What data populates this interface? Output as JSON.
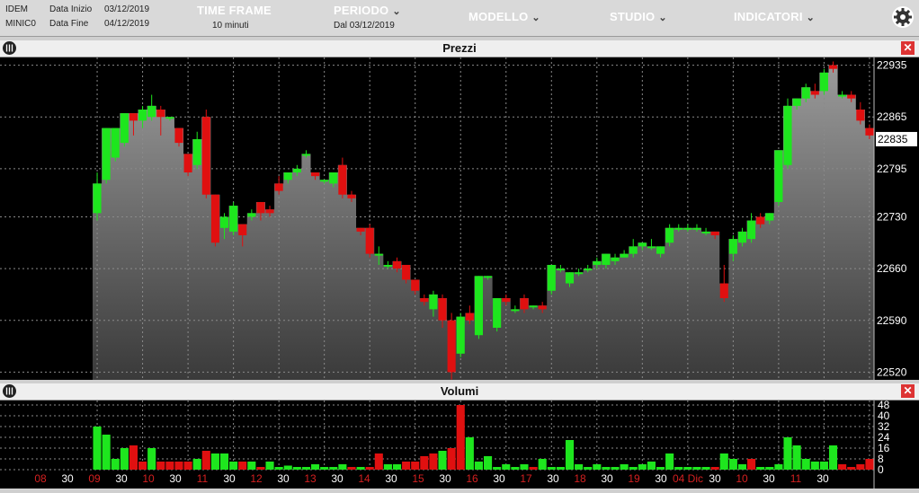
{
  "header": {
    "market": "IDEM",
    "symbol": "MINIC0",
    "start_label": "Data Inizio",
    "start_value": "03/12/2019",
    "end_label": "Data Fine",
    "end_value": "04/12/2019",
    "timeframe_label": "TIME FRAME",
    "timeframe_value": "10 minuti",
    "period_label": "PERIODO",
    "period_value": "Dal 03/12/2019",
    "menu_model": "MODELLO",
    "menu_study": "STUDIO",
    "menu_indicators": "INDICATORI",
    "settings_icon": "gear-icon",
    "close_icon": "close-icon"
  },
  "chart_data": [
    {
      "type": "candlestick",
      "title": "Prezzi",
      "y_ticks": [
        22520,
        22590,
        22660,
        22730,
        22795,
        22865,
        22935
      ],
      "ylim": [
        22512,
        22943
      ],
      "last_price": "22835",
      "x_tick_labels": [
        "08",
        "30",
        "09",
        "30",
        "10",
        "30",
        "11",
        "30",
        "12",
        "30",
        "13",
        "30",
        "14",
        "30",
        "15",
        "30",
        "16",
        "30",
        "17",
        "30",
        "18",
        "30",
        "19",
        "30",
        "04 Dic",
        "30",
        "10",
        "30",
        "11",
        "30"
      ],
      "colors": {
        "up": "#1ee61e",
        "down": "#e01010",
        "area_top": "#9a9a9a",
        "area_bottom": "#3a3a3a"
      },
      "candles": [
        {
          "o": 22735,
          "h": 22790,
          "c": 22775,
          "l": 22725
        },
        {
          "o": 22780,
          "h": 22850,
          "c": 22850,
          "l": 22775
        },
        {
          "o": 22810,
          "h": 22850,
          "c": 22850,
          "l": 22805
        },
        {
          "o": 22830,
          "h": 22870,
          "c": 22870,
          "l": 22825
        },
        {
          "o": 22870,
          "h": 22870,
          "c": 22860,
          "l": 22840
        },
        {
          "o": 22860,
          "h": 22880,
          "c": 22875,
          "l": 22850
        },
        {
          "o": 22865,
          "h": 22895,
          "c": 22880,
          "l": 22860
        },
        {
          "o": 22875,
          "h": 22880,
          "c": 22865,
          "l": 22840
        },
        {
          "o": 22865,
          "h": 22865,
          "c": 22865,
          "l": 22860
        },
        {
          "o": 22850,
          "h": 22850,
          "c": 22830,
          "l": 22825
        },
        {
          "o": 22815,
          "h": 22815,
          "c": 22790,
          "l": 22785
        },
        {
          "o": 22800,
          "h": 22845,
          "c": 22835,
          "l": 22795
        },
        {
          "o": 22865,
          "h": 22875,
          "c": 22760,
          "l": 22755
        },
        {
          "o": 22760,
          "h": 22760,
          "c": 22695,
          "l": 22690
        },
        {
          "o": 22715,
          "h": 22735,
          "c": 22730,
          "l": 22700
        },
        {
          "o": 22710,
          "h": 22750,
          "c": 22745,
          "l": 22705
        },
        {
          "o": 22720,
          "h": 22720,
          "c": 22705,
          "l": 22690
        },
        {
          "o": 22730,
          "h": 22740,
          "c": 22735,
          "l": 22725
        },
        {
          "o": 22750,
          "h": 22750,
          "c": 22735,
          "l": 22725
        },
        {
          "o": 22740,
          "h": 22745,
          "c": 22735,
          "l": 22730
        },
        {
          "o": 22775,
          "h": 22785,
          "c": 22765,
          "l": 22760
        },
        {
          "o": 22780,
          "h": 22790,
          "c": 22790,
          "l": 22775
        },
        {
          "o": 22790,
          "h": 22800,
          "c": 22795,
          "l": 22785
        },
        {
          "o": 22815,
          "h": 22820,
          "c": 22815,
          "l": 22810
        },
        {
          "o": 22790,
          "h": 22790,
          "c": 22785,
          "l": 22780
        },
        {
          "o": 22780,
          "h": 22780,
          "c": 22780,
          "l": 22775
        },
        {
          "o": 22775,
          "h": 22790,
          "c": 22790,
          "l": 22770
        },
        {
          "o": 22800,
          "h": 22810,
          "c": 22760,
          "l": 22755
        },
        {
          "o": 22760,
          "h": 22765,
          "c": 22755,
          "l": 22750
        },
        {
          "o": 22715,
          "h": 22715,
          "c": 22710,
          "l": 22705
        },
        {
          "o": 22715,
          "h": 22720,
          "c": 22680,
          "l": 22675
        },
        {
          "o": 22680,
          "h": 22690,
          "c": 22680,
          "l": 22665
        },
        {
          "o": 22665,
          "h": 22670,
          "c": 22665,
          "l": 22660
        },
        {
          "o": 22670,
          "h": 22675,
          "c": 22660,
          "l": 22655
        },
        {
          "o": 22665,
          "h": 22665,
          "c": 22645,
          "l": 22640
        },
        {
          "o": 22645,
          "h": 22645,
          "c": 22630,
          "l": 22625
        },
        {
          "o": 22620,
          "h": 22625,
          "c": 22615,
          "l": 22610
        },
        {
          "o": 22605,
          "h": 22630,
          "c": 22625,
          "l": 22595
        },
        {
          "o": 22620,
          "h": 22625,
          "c": 22590,
          "l": 22580
        },
        {
          "o": 22590,
          "h": 22600,
          "c": 22520,
          "l": 22510
        },
        {
          "o": 22545,
          "h": 22600,
          "c": 22595,
          "l": 22540
        },
        {
          "o": 22600,
          "h": 22610,
          "c": 22590,
          "l": 22585
        },
        {
          "o": 22570,
          "h": 22650,
          "c": 22650,
          "l": 22565
        },
        {
          "o": 22650,
          "h": 22650,
          "c": 22650,
          "l": 22645
        },
        {
          "o": 22580,
          "h": 22620,
          "c": 22620,
          "l": 22575
        },
        {
          "o": 22620,
          "h": 22625,
          "c": 22615,
          "l": 22610
        },
        {
          "o": 22605,
          "h": 22610,
          "c": 22605,
          "l": 22600
        },
        {
          "o": 22620,
          "h": 22625,
          "c": 22605,
          "l": 22600
        },
        {
          "o": 22610,
          "h": 22610,
          "c": 22610,
          "l": 22605
        },
        {
          "o": 22610,
          "h": 22615,
          "c": 22605,
          "l": 22600
        },
        {
          "o": 22630,
          "h": 22665,
          "c": 22665,
          "l": 22625
        },
        {
          "o": 22660,
          "h": 22665,
          "c": 22660,
          "l": 22655
        },
        {
          "o": 22640,
          "h": 22655,
          "c": 22655,
          "l": 22635
        },
        {
          "o": 22655,
          "h": 22660,
          "c": 22655,
          "l": 22650
        },
        {
          "o": 22660,
          "h": 22665,
          "c": 22660,
          "l": 22655
        },
        {
          "o": 22665,
          "h": 22675,
          "c": 22670,
          "l": 22660
        },
        {
          "o": 22665,
          "h": 22680,
          "c": 22680,
          "l": 22660
        },
        {
          "o": 22670,
          "h": 22680,
          "c": 22675,
          "l": 22665
        },
        {
          "o": 22675,
          "h": 22685,
          "c": 22680,
          "l": 22675
        },
        {
          "o": 22680,
          "h": 22700,
          "c": 22690,
          "l": 22675
        },
        {
          "o": 22690,
          "h": 22695,
          "c": 22695,
          "l": 22685
        },
        {
          "o": 22690,
          "h": 22700,
          "c": 22690,
          "l": 22685
        },
        {
          "o": 22680,
          "h": 22690,
          "c": 22690,
          "l": 22675
        },
        {
          "o": 22695,
          "h": 22720,
          "c": 22715,
          "l": 22690
        },
        {
          "o": 22715,
          "h": 22720,
          "c": 22715,
          "l": 22710
        },
        {
          "o": 22715,
          "h": 22720,
          "c": 22715,
          "l": 22710
        },
        {
          "o": 22715,
          "h": 22720,
          "c": 22715,
          "l": 22710
        },
        {
          "o": 22710,
          "h": 22715,
          "c": 22710,
          "l": 22705
        },
        {
          "o": 22710,
          "h": 22710,
          "c": 22705,
          "l": 22700
        },
        {
          "o": 22640,
          "h": 22665,
          "c": 22620,
          "l": 22615
        },
        {
          "o": 22680,
          "h": 22705,
          "c": 22700,
          "l": 22670
        },
        {
          "o": 22695,
          "h": 22715,
          "c": 22710,
          "l": 22690
        },
        {
          "o": 22700,
          "h": 22735,
          "c": 22725,
          "l": 22695
        },
        {
          "o": 22730,
          "h": 22735,
          "c": 22720,
          "l": 22715
        },
        {
          "o": 22725,
          "h": 22735,
          "c": 22735,
          "l": 22720
        },
        {
          "o": 22750,
          "h": 22820,
          "c": 22820,
          "l": 22745
        },
        {
          "o": 22800,
          "h": 22890,
          "c": 22880,
          "l": 22795
        },
        {
          "o": 22880,
          "h": 22890,
          "c": 22890,
          "l": 22875
        },
        {
          "o": 22890,
          "h": 22910,
          "c": 22905,
          "l": 22885
        },
        {
          "o": 22900,
          "h": 22910,
          "c": 22895,
          "l": 22890
        },
        {
          "o": 22900,
          "h": 22930,
          "c": 22925,
          "l": 22895
        },
        {
          "o": 22935,
          "h": 22940,
          "c": 22930,
          "l": 22925
        },
        {
          "o": 22895,
          "h": 22900,
          "c": 22895,
          "l": 22890
        },
        {
          "o": 22895,
          "h": 22900,
          "c": 22890,
          "l": 22885
        },
        {
          "o": 22875,
          "h": 22885,
          "c": 22860,
          "l": 22855
        },
        {
          "o": 22850,
          "h": 22855,
          "c": 22840,
          "l": 22835
        }
      ]
    },
    {
      "type": "bar",
      "title": "Volumi",
      "y_ticks": [
        0,
        8,
        16,
        24,
        32,
        40,
        48
      ],
      "ylim": [
        0,
        48
      ],
      "values": [
        32,
        26,
        8,
        16,
        18,
        6,
        16,
        6,
        6,
        6,
        6,
        8,
        14,
        12,
        12,
        6,
        6,
        6,
        2,
        6,
        2,
        3,
        2,
        2,
        4,
        2,
        2,
        4,
        2,
        2,
        2,
        12,
        4,
        4,
        6,
        6,
        10,
        12,
        14,
        16,
        48,
        24,
        6,
        10,
        2,
        4,
        2,
        4,
        2,
        8,
        2,
        2,
        22,
        4,
        2,
        4,
        2,
        2,
        4,
        2,
        4,
        6,
        2,
        12,
        2,
        2,
        2,
        2,
        2,
        12,
        8,
        4,
        8,
        2,
        2,
        4,
        24,
        18,
        8,
        6,
        6,
        18,
        4,
        2,
        4,
        8,
        8,
        10
      ],
      "up": [
        1,
        1,
        1,
        1,
        0,
        0,
        1,
        0,
        0,
        0,
        0,
        1,
        0,
        1,
        1,
        1,
        0,
        1,
        0,
        1,
        1,
        1,
        1,
        1,
        1,
        1,
        1,
        1,
        0,
        1,
        0,
        0,
        1,
        1,
        0,
        0,
        0,
        0,
        1,
        0,
        0,
        1,
        1,
        1,
        1,
        1,
        1,
        1,
        0,
        1,
        1,
        1,
        1,
        1,
        1,
        1,
        1,
        1,
        1,
        1,
        1,
        1,
        1,
        1,
        1,
        1,
        1,
        1,
        0,
        1,
        1,
        1,
        0,
        1,
        1,
        1,
        1,
        1,
        1,
        1,
        1,
        1,
        0,
        0,
        0,
        0,
        0,
        0
      ]
    }
  ]
}
